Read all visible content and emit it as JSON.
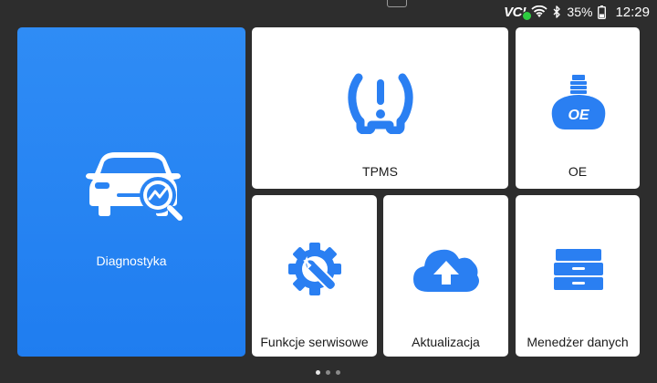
{
  "status": {
    "vci_label": "VC!",
    "battery": "35%",
    "time": "12:29"
  },
  "tiles": {
    "diagnostics": "Diagnostyka",
    "tpms": "TPMS",
    "oe": "OE",
    "service": "Funkcje serwisowe",
    "update": "Aktualizacja",
    "data_manager": "Menedżer danych"
  },
  "oe_badge": "OE",
  "pager": {
    "pages": 3,
    "current": 1
  },
  "colors": {
    "accent": "#1f7df0",
    "icon_blue": "#2a7ff2",
    "background": "#2d2d2d",
    "tile": "#ffffff",
    "vci_ok": "#2ecc40"
  },
  "icons": [
    "wifi-icon",
    "bluetooth-icon",
    "battery-icon",
    "car-diagnostic-icon",
    "tire-pressure-icon",
    "oe-bottle-icon",
    "service-gear-wrench-icon",
    "cloud-upload-icon",
    "drawer-cabinet-icon"
  ]
}
